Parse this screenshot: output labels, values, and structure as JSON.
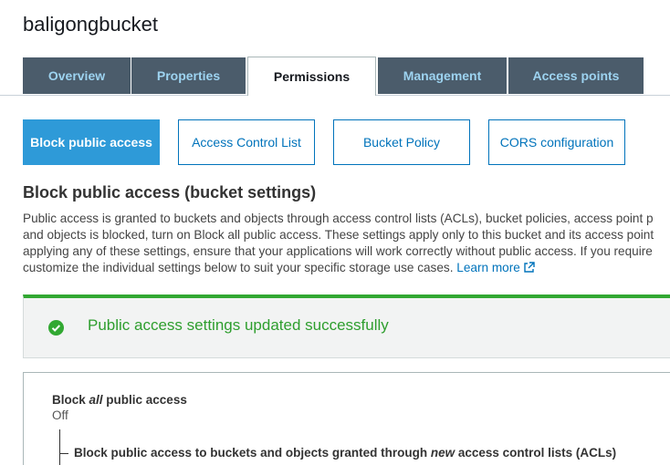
{
  "bucket": {
    "name": "baligongbucket"
  },
  "tabs": [
    {
      "label": "Overview",
      "active": false
    },
    {
      "label": "Properties",
      "active": false
    },
    {
      "label": "Permissions",
      "active": true
    },
    {
      "label": "Management",
      "active": false
    },
    {
      "label": "Access points",
      "active": false
    }
  ],
  "subtabs": [
    {
      "label": "Block public access",
      "active": true
    },
    {
      "label": "Access Control List",
      "active": false
    },
    {
      "label": "Bucket Policy",
      "active": false
    },
    {
      "label": "CORS configuration",
      "active": false
    }
  ],
  "section": {
    "title": "Block public access (bucket settings)",
    "description_lines": [
      "Public access is granted to buckets and objects through access control lists (ACLs), bucket policies, access point p",
      "and objects is blocked, turn on Block all public access. These settings apply only to this bucket and its access point",
      "applying any of these settings, ensure that your applications will work correctly without public access. If you require",
      "customize the individual settings below to suit your specific storage use cases."
    ],
    "learn_more": "Learn more"
  },
  "flash": {
    "message": "Public access settings updated successfully",
    "color": "#2e9e2e"
  },
  "settings": {
    "block_all": {
      "prefix": "Block ",
      "emph": "all",
      "suffix": " public access",
      "value": "Off"
    },
    "block_new_acl": {
      "prefix": "Block public access to buckets and objects granted through ",
      "emph": "new",
      "suffix": " access control lists (ACLs)"
    }
  },
  "colors": {
    "tab_bg": "#4b5c6b",
    "tab_text": "#9dd3f0",
    "accent": "#0073bb",
    "active_subtab": "#2e9ad8",
    "success": "#32a832"
  }
}
